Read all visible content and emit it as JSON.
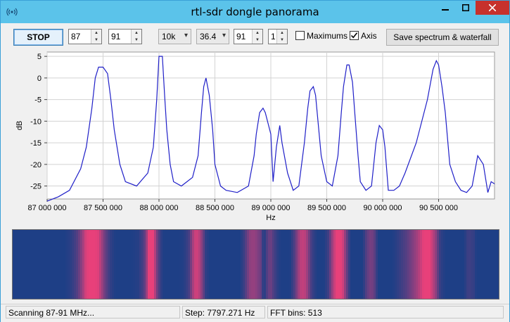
{
  "window": {
    "title": "rtl-sdr dongle panorama"
  },
  "toolbar": {
    "stop_label": "STOP",
    "freq_start": "87",
    "freq_end": "91",
    "bandwidth": "10k",
    "gain": "36.4",
    "fft_size": "91",
    "averaging": "1",
    "maximums_label": "Maximums",
    "maximums_checked": false,
    "axis_label": "Axis",
    "axis_checked": true,
    "save_label": "Save spectrum & waterfall"
  },
  "statusbar": {
    "status": "Scanning 87-91 MHz...",
    "step": "Step: 7797.271 Hz",
    "fft_bins": "FFT bins: 513"
  },
  "colors": {
    "titlebar": "#5bc3ea",
    "close_button": "#c7312c",
    "trace": "#1f1fc8",
    "waterfall_bg": "#1e3f86",
    "waterfall_hot": "#e8407a"
  },
  "chart_data": {
    "type": "line",
    "xlabel": "Hz",
    "ylabel": "dB",
    "xlim": [
      87000000,
      91000000
    ],
    "ylim": [
      -28,
      6
    ],
    "grid": true,
    "x_ticks": [
      87000000,
      87500000,
      88000000,
      88500000,
      89000000,
      89500000,
      90000000,
      90500000
    ],
    "x_tick_labels": [
      "87 000 000",
      "87 500 000",
      "88 000 000",
      "88 500 000",
      "89 000 000",
      "89 500 000",
      "90 000 000",
      "90 500 000"
    ],
    "y_ticks": [
      5,
      0,
      -5,
      -10,
      -15,
      -20,
      -25
    ],
    "y_tick_labels": [
      "5",
      "0",
      "-5",
      "-10",
      "-15",
      "-20",
      "-25"
    ],
    "series": [
      {
        "x": [
          87000000,
          87100000,
          87200000,
          87300000,
          87350000,
          87400000,
          87430000,
          87460000,
          87500000,
          87540000,
          87570000,
          87600000,
          87650000,
          87700000,
          87800000,
          87900000,
          87950000,
          87980000,
          88000000,
          88030000,
          88050000,
          88070000,
          88100000,
          88130000,
          88200000,
          88300000,
          88350000,
          88380000,
          88400000,
          88420000,
          88450000,
          88480000,
          88500000,
          88550000,
          88600000,
          88700000,
          88800000,
          88850000,
          88870000,
          88900000,
          88930000,
          88950000,
          89000000,
          89020000,
          89050000,
          89080000,
          89100000,
          89150000,
          89200000,
          89250000,
          89300000,
          89330000,
          89350000,
          89380000,
          89400000,
          89450000,
          89500000,
          89550000,
          89600000,
          89630000,
          89650000,
          89680000,
          89700000,
          89730000,
          89750000,
          89780000,
          89800000,
          89850000,
          89900000,
          89940000,
          89970000,
          90000000,
          90020000,
          90050000,
          90100000,
          90150000,
          90200000,
          90300000,
          90400000,
          90450000,
          90480000,
          90500000,
          90530000,
          90560000,
          90600000,
          90650000,
          90700000,
          90750000,
          90800000,
          90850000,
          90900000,
          90940000,
          90970000,
          91000000
        ],
        "y": [
          -28.5,
          -27.5,
          -26,
          -21,
          -16,
          -7,
          0,
          2.5,
          2.5,
          1,
          -5,
          -12,
          -20,
          -24,
          -25,
          -22,
          -16,
          -5,
          5,
          5,
          -4,
          -12,
          -20,
          -24,
          -25,
          -23,
          -18,
          -8,
          -2,
          0,
          -4,
          -12,
          -20,
          -25,
          -26,
          -26.5,
          -25,
          -18,
          -13,
          -8,
          -7,
          -8,
          -13,
          -24,
          -16,
          -11,
          -15,
          -22,
          -26,
          -25,
          -15,
          -7,
          -3,
          -2,
          -4,
          -18,
          -24,
          -25,
          -18,
          -8,
          -2,
          3,
          3,
          -1,
          -8,
          -18,
          -24,
          -26,
          -25,
          -15,
          -11,
          -12,
          -16,
          -26,
          -26,
          -25,
          -22,
          -15,
          -5,
          2,
          4,
          3,
          -2,
          -8,
          -20,
          -24,
          -26,
          -26.5,
          -25,
          -18,
          -20,
          -26.5,
          -24,
          -24.5
        ]
      }
    ]
  }
}
